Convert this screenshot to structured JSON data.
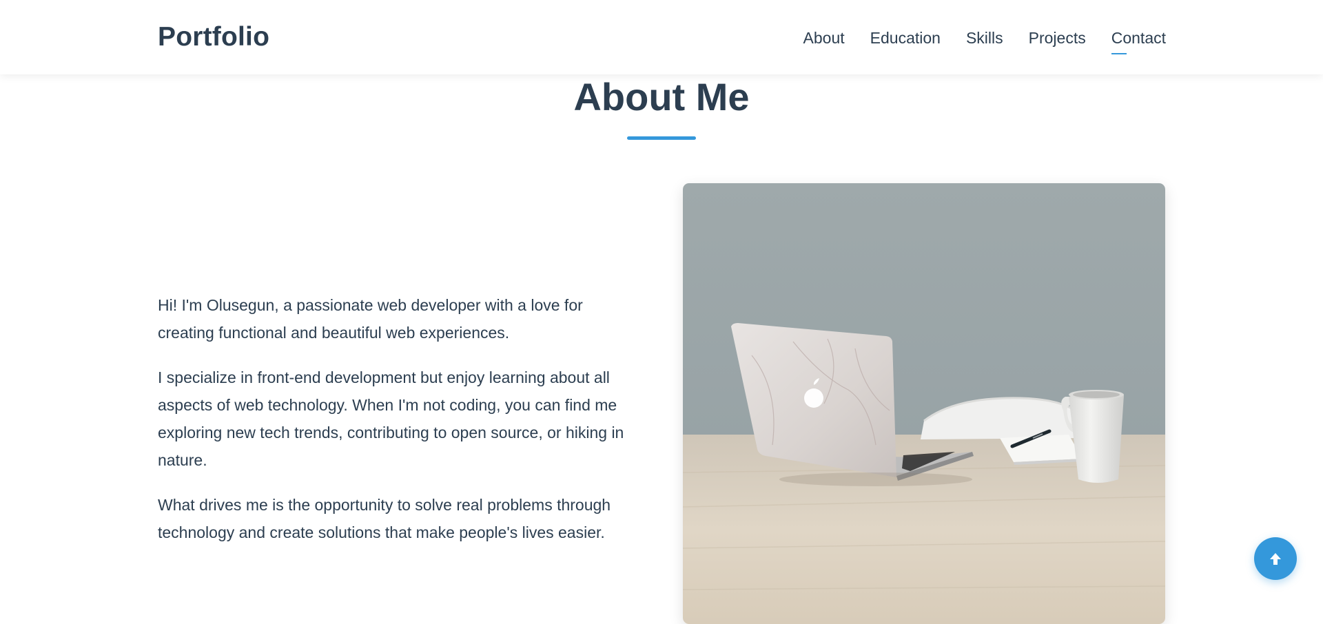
{
  "nav": {
    "brand": "Portfolio",
    "links": [
      {
        "label": "About"
      },
      {
        "label": "Education"
      },
      {
        "label": "Skills"
      },
      {
        "label": "Projects"
      },
      {
        "label": "Contact"
      }
    ],
    "active_link": "Contact"
  },
  "about": {
    "title": "About Me",
    "paragraphs": [
      "Hi! I'm Olusegun, a passionate web developer with a love for creating functional and beautiful web experiences.",
      "I specialize in front-end development but enjoy learning about all aspects of web technology. When I'm not coding, you can find me exploring new tech trends, contributing to open source, or hiking in nature.",
      "What drives me is the opportunity to solve real problems through technology and create solutions that make people's lives easier."
    ],
    "image_subject": "laptop-on-desk-photo"
  },
  "scroll_top": {
    "icon": "arrow-up-icon"
  },
  "colors": {
    "accent": "#3498db",
    "text": "#2c3e50",
    "background": "#ffffff"
  }
}
